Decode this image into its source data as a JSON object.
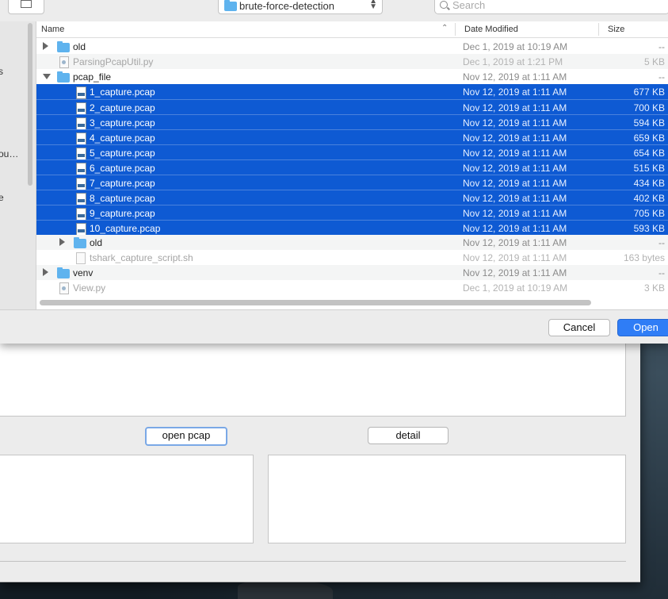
{
  "toolbar": {
    "location": "brute-force-detection",
    "search_placeholder": "Search"
  },
  "sidebar": {
    "items": [
      {
        "label": "s"
      },
      {
        "label": "ou…"
      },
      {
        "label": "e"
      }
    ]
  },
  "columns": {
    "name": "Name",
    "date_modified": "Date Modified",
    "size": "Size"
  },
  "files": [
    {
      "name": "old",
      "date": "Dec 1, 2019 at 10:19 AM",
      "size": "--",
      "type": "folder"
    },
    {
      "name": "ParsingPcapUtil.py",
      "date": "Dec 1, 2019 at 1:21 PM",
      "size": "5 KB",
      "type": "py"
    },
    {
      "name": "pcap_file",
      "date": "Nov 12, 2019 at 1:11 AM",
      "size": "--",
      "type": "folder"
    },
    {
      "name": "1_capture.pcap",
      "date": "Nov 12, 2019 at 1:11 AM",
      "size": "677 KB",
      "type": "pcap"
    },
    {
      "name": "2_capture.pcap",
      "date": "Nov 12, 2019 at 1:11 AM",
      "size": "700 KB",
      "type": "pcap"
    },
    {
      "name": "3_capture.pcap",
      "date": "Nov 12, 2019 at 1:11 AM",
      "size": "594 KB",
      "type": "pcap"
    },
    {
      "name": "4_capture.pcap",
      "date": "Nov 12, 2019 at 1:11 AM",
      "size": "659 KB",
      "type": "pcap"
    },
    {
      "name": "5_capture.pcap",
      "date": "Nov 12, 2019 at 1:11 AM",
      "size": "654 KB",
      "type": "pcap"
    },
    {
      "name": "6_capture.pcap",
      "date": "Nov 12, 2019 at 1:11 AM",
      "size": "515 KB",
      "type": "pcap"
    },
    {
      "name": "7_capture.pcap",
      "date": "Nov 12, 2019 at 1:11 AM",
      "size": "434 KB",
      "type": "pcap"
    },
    {
      "name": "8_capture.pcap",
      "date": "Nov 12, 2019 at 1:11 AM",
      "size": "402 KB",
      "type": "pcap"
    },
    {
      "name": "9_capture.pcap",
      "date": "Nov 12, 2019 at 1:11 AM",
      "size": "705 KB",
      "type": "pcap"
    },
    {
      "name": "10_capture.pcap",
      "date": "Nov 12, 2019 at 1:11 AM",
      "size": "593 KB",
      "type": "pcap"
    },
    {
      "name": "old",
      "date": "Nov 12, 2019 at 1:11 AM",
      "size": "--",
      "type": "folder"
    },
    {
      "name": "tshark_capture_script.sh",
      "date": "Nov 12, 2019 at 1:11 AM",
      "size": "163 bytes",
      "type": "sh"
    },
    {
      "name": "venv",
      "date": "Nov 12, 2019 at 1:11 AM",
      "size": "--",
      "type": "folder"
    },
    {
      "name": "View.py",
      "date": "Dec 1, 2019 at 10:19 AM",
      "size": "3 KB",
      "type": "py"
    }
  ],
  "dialog_buttons": {
    "cancel": "Cancel",
    "open": "Open"
  },
  "app": {
    "open_pcap_label": "open pcap",
    "detail_label": "detail"
  },
  "colors": {
    "selection": "#0e5ad3",
    "primary_button": "#2f7df6",
    "folder": "#5fb3ee"
  }
}
